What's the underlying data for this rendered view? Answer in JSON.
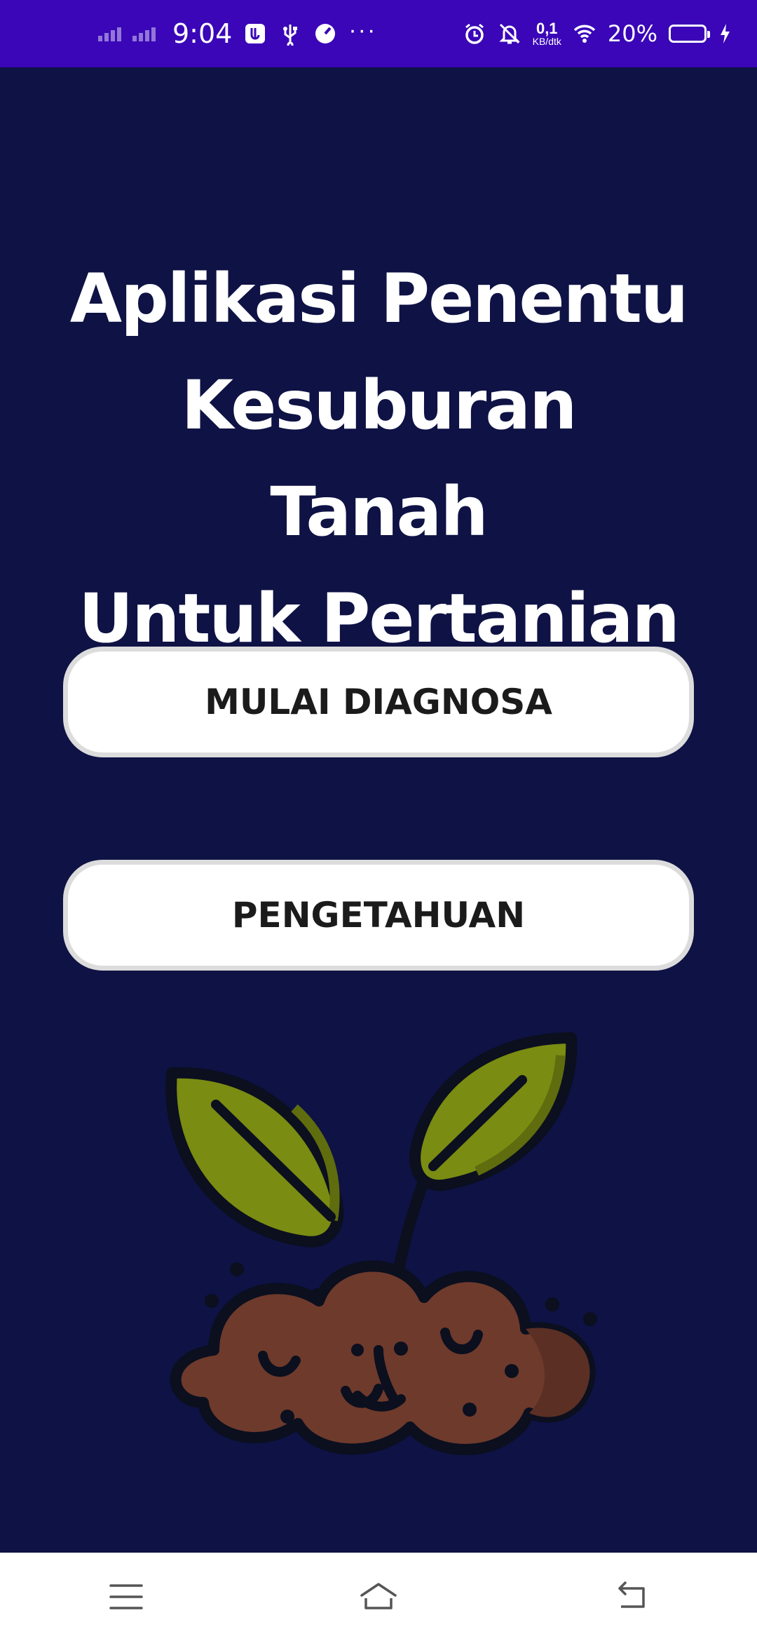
{
  "status_bar": {
    "time": "9:04",
    "net_speed_value": "0,1",
    "net_speed_unit": "KB/dtk",
    "battery_percent": "20%",
    "battery_level": 0.2,
    "more_indicator": "···",
    "icons": [
      "signal-icon",
      "usb-debug-icon",
      "usb-icon",
      "speedometer-icon",
      "alarm-icon",
      "bell-off-icon",
      "wifi-icon",
      "battery-icon",
      "charging-icon"
    ]
  },
  "main": {
    "title_lines": [
      "Aplikasi Penentu",
      "Kesuburan Tanah",
      "Untuk Pertanian"
    ],
    "buttons": {
      "diagnosa": "MULAI DIAGNOSA",
      "pengetahuan": "PENGETAHUAN"
    },
    "illustration": "sprout-in-soil"
  },
  "nav_bar": {
    "icons": [
      "menu-icon",
      "home-icon",
      "back-icon"
    ]
  },
  "colors": {
    "status_bar": "#3a06b8",
    "background": "#0e1244",
    "button_bg": "#ffffff",
    "button_border": "#dcdcdc",
    "leaf": "#7a8c12",
    "soil": "#6e3a2c"
  }
}
